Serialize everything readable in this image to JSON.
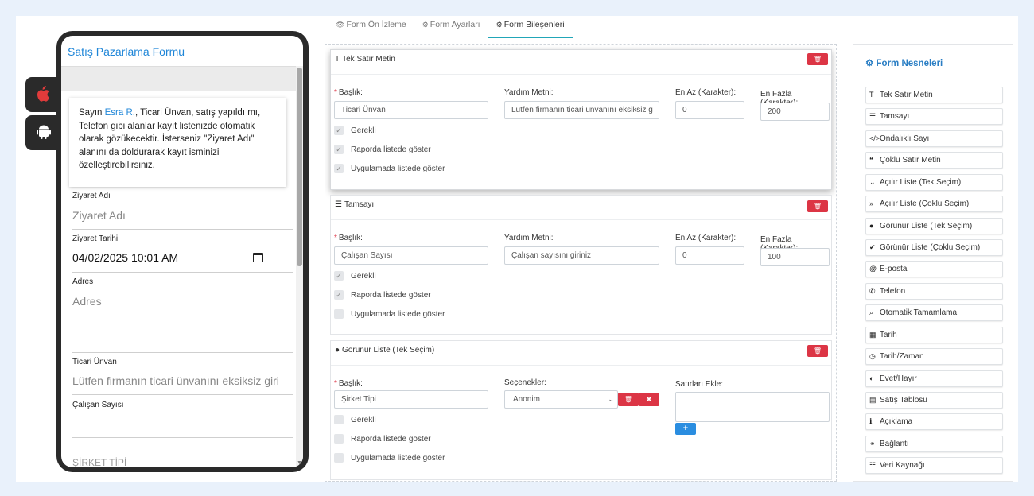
{
  "tabs": [
    {
      "icon": "👁",
      "label": "Form Ön İzleme"
    },
    {
      "icon": "⚙",
      "label": "Form Ayarları"
    },
    {
      "icon": "⚙",
      "label": "Form Bileşenleri"
    }
  ],
  "phone": {
    "form_title": "Satış Pazarlama Formu",
    "info": {
      "prefix": "Sayın ",
      "name": "Esra R.",
      "text": ", Ticari Ünvan, satış yapıldı mı, Telefon gibi alanlar kayıt listenizde otomatik olarak gözükecektir. İsterseniz \"Ziyaret Adı\" alanını da doldurarak kayıt isminizi özelleştirebilirsiniz."
    },
    "fields": {
      "ziyaret_adi": {
        "label": "Ziyaret Adı",
        "placeholder": "Ziyaret Adı"
      },
      "ziyaret_tarihi": {
        "label": "Ziyaret Tarihi",
        "value": "04/02/2025 10:01 AM"
      },
      "adres": {
        "label": "Adres",
        "placeholder": "Adres"
      },
      "ticari_unvan": {
        "label": "Ticari Ünvan",
        "placeholder": "Lütfen firmanın ticari ünvanını eksiksiz giri"
      },
      "calisan_sayisi": {
        "label": "Çalışan Sayısı"
      },
      "sirket_tipi": {
        "label": "ŞİRKET TİPİ"
      }
    }
  },
  "editor": {
    "cards": [
      {
        "icon": "T",
        "title": "Tek Satır Metin",
        "baslik_label": "Başlık:",
        "baslik_value": "Ticari Ünvan",
        "yardim_label": "Yardım Metni:",
        "yardim_value": "Lütfen firmanın ticari ünvanını eksiksiz g",
        "enaz_label": "En Az (Karakter):",
        "enaz_value": "0",
        "enfazla_label": "En Fazla (Karakter):",
        "enfazla_value": "200",
        "checks": [
          {
            "label": "Gerekli",
            "checked": "✓"
          },
          {
            "label": "Raporda listede göster",
            "checked": "✓"
          },
          {
            "label": "Uygulamada listede göster",
            "checked": "✓"
          }
        ]
      },
      {
        "icon": "☰",
        "title": "Tamsayı",
        "baslik_label": "Başlık:",
        "baslik_value": "Çalışan Sayısı",
        "yardim_label": "Yardım Metni:",
        "yardim_value": "Çalışan sayısını giriniz",
        "enaz_label": "En Az (Karakter):",
        "enaz_value": "0",
        "enfazla_label": "En Fazla (Karakter):",
        "enfazla_value": "100",
        "checks": [
          {
            "label": "Gerekli",
            "checked": "✓"
          },
          {
            "label": "Raporda listede göster",
            "checked": "✓"
          },
          {
            "label": "Uygulamada listede göster",
            "checked": ""
          }
        ]
      },
      {
        "icon": "●",
        "title": "Görünür Liste (Tek Seçim)",
        "baslik_label": "Başlık:",
        "baslik_value": "Şirket Tipi",
        "secenekler_label": "Seçenekler:",
        "secenekler_value": "Anonim",
        "satirlar_label": "Satırları Ekle:",
        "checks": [
          {
            "label": "Gerekli",
            "checked": ""
          },
          {
            "label": "Raporda listede göster",
            "checked": ""
          },
          {
            "label": "Uygulamada listede göster",
            "checked": ""
          }
        ]
      }
    ],
    "delete_icon": "🗑",
    "remove_icon": "✖",
    "add_icon": "+"
  },
  "objects": {
    "title": "Form Nesneleri",
    "title_icon": "⚙",
    "items": [
      {
        "icon": "T",
        "label": "Tek Satır Metin"
      },
      {
        "icon": "☰",
        "label": "Tamsayı"
      },
      {
        "icon": "</>",
        "label": "Ondalıklı Sayı"
      },
      {
        "icon": "❝",
        "label": "Çoklu Satır Metin"
      },
      {
        "icon": "⌄",
        "label": "Açılır Liste (Tek Seçim)"
      },
      {
        "icon": "»",
        "label": "Açılır Liste (Çoklu Seçim)"
      },
      {
        "icon": "●",
        "label": "Görünür Liste (Tek Seçim)"
      },
      {
        "icon": "✔",
        "label": "Görünür Liste (Çoklu Seçim)"
      },
      {
        "icon": "@",
        "label": "E-posta"
      },
      {
        "icon": "✆",
        "label": "Telefon"
      },
      {
        "icon": "⌕",
        "label": "Otomatik Tamamlama"
      },
      {
        "icon": "▦",
        "label": "Tarih"
      },
      {
        "icon": "◷",
        "label": "Tarih/Zaman"
      },
      {
        "icon": "◐",
        "label": "Evet/Hayır"
      },
      {
        "icon": "▤",
        "label": "Satış Tablosu"
      },
      {
        "icon": "ℹ",
        "label": "Açıklama"
      },
      {
        "icon": "⚭",
        "label": "Bağlantı"
      },
      {
        "icon": "☷",
        "label": "Veri Kaynağı"
      }
    ]
  },
  "platforms": {
    "ios_icon": "",
    "android_icon": "🤖"
  }
}
